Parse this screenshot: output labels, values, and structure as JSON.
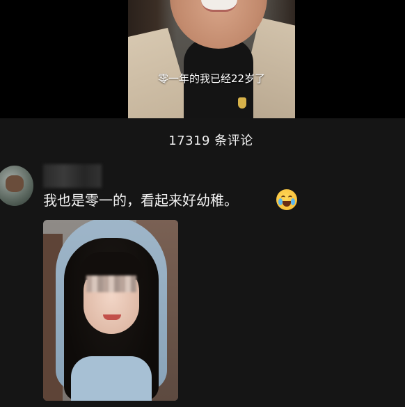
{
  "video": {
    "caption": "零一年的我已经22岁了"
  },
  "comments": {
    "count_label": "17319 条评论"
  },
  "comment": {
    "text": "我也是零一的，看起来好幼稚。",
    "emoji": "crying-laughing-emoji-icon"
  },
  "colors": {
    "background": "#151515",
    "top_band": "#000000",
    "text": "#f0f0f0"
  }
}
